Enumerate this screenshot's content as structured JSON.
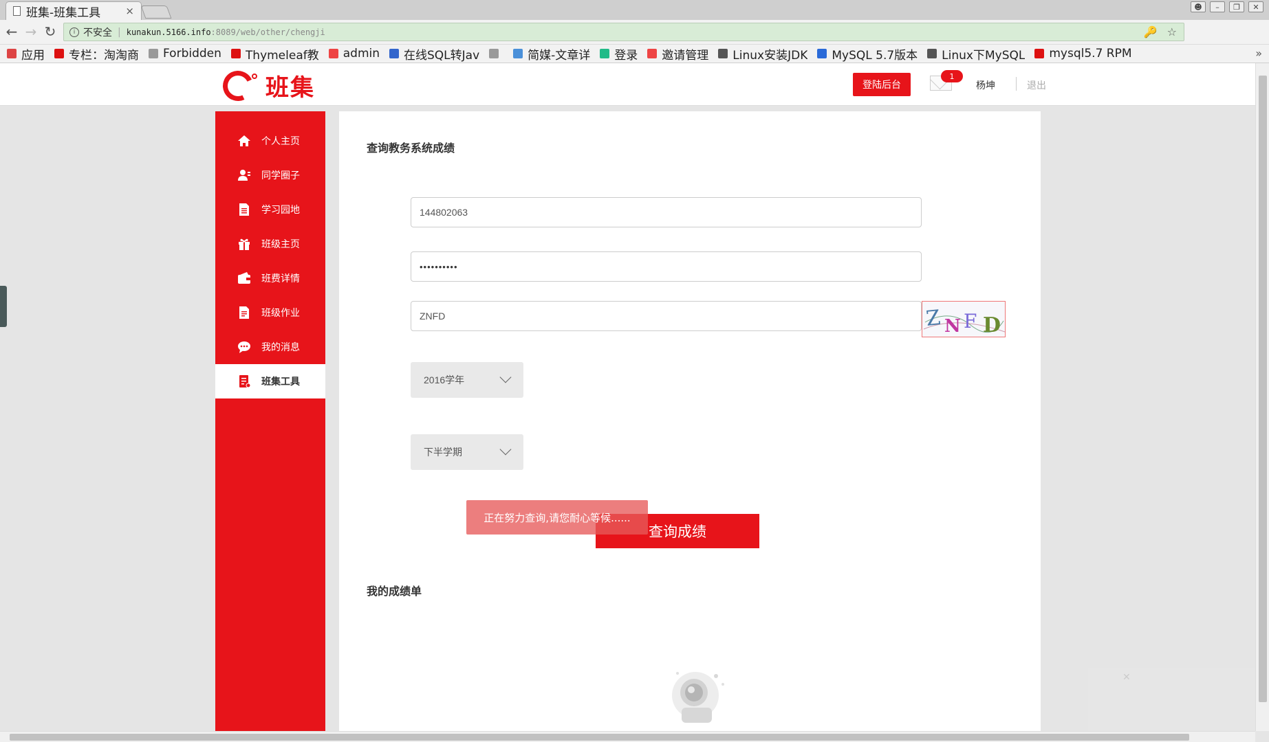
{
  "browser": {
    "tab_title": "班集-班集工具",
    "tab_close": "×",
    "security_label": "不安全",
    "url_host": "kunakun.5166.info",
    "url_path": ":8089/web/other/chengji",
    "bookmarks": [
      {
        "label": "应用",
        "icon": "apps-icon",
        "color": "#d44"
      },
      {
        "label": "专栏：淘淘商",
        "icon": "csdn-icon",
        "color": "#d11"
      },
      {
        "label": "Forbidden",
        "icon": "page-icon",
        "color": "#999"
      },
      {
        "label": "Thymeleaf教",
        "icon": "csdn-icon",
        "color": "#d11"
      },
      {
        "label": "admin",
        "icon": "jm-icon",
        "color": "#e44"
      },
      {
        "label": "在线SQL转Jav",
        "icon": "code-icon",
        "color": "#36c"
      },
      {
        "label": "",
        "icon": "page-icon",
        "color": "#999"
      },
      {
        "label": "简媒-文章详",
        "icon": "jm-blue-icon",
        "color": "#4a90d9"
      },
      {
        "label": "登录",
        "icon": "green-icon",
        "color": "#2b8"
      },
      {
        "label": "邀请管理",
        "icon": "jm-icon",
        "color": "#e44"
      },
      {
        "label": "Linux安装JDK",
        "icon": "linux-icon",
        "color": "#555"
      },
      {
        "label": "MySQL 5.7版本",
        "icon": "baidu-icon",
        "color": "#2a6ad8"
      },
      {
        "label": "Linux下MySQL",
        "icon": "linux-icon",
        "color": "#555"
      },
      {
        "label": "mysql5.7 RPM",
        "icon": "csdn-icon",
        "color": "#d11"
      }
    ]
  },
  "header": {
    "logo_text": "班集",
    "admin_button": "登陆后台",
    "mail_badge": "1",
    "username": "杨坤",
    "logout": "退出"
  },
  "sidebar": {
    "items": [
      {
        "label": "个人主页",
        "icon": "home-icon",
        "active": false
      },
      {
        "label": "同学圈子",
        "icon": "user-icon",
        "active": false
      },
      {
        "label": "学习园地",
        "icon": "document-icon",
        "active": false
      },
      {
        "label": "班级主页",
        "icon": "gift-icon",
        "active": false
      },
      {
        "label": "班费详情",
        "icon": "wallet-icon",
        "active": false
      },
      {
        "label": "班级作业",
        "icon": "homework-icon",
        "active": false
      },
      {
        "label": "我的消息",
        "icon": "chat-icon",
        "active": false
      },
      {
        "label": "班集工具",
        "icon": "tools-icon",
        "active": true
      }
    ]
  },
  "main": {
    "title": "查询教务系统成绩",
    "student_id": "144802063",
    "password_mask": "••••••••••",
    "captcha_value": "ZNFD",
    "captcha_image_text": "ZNFD",
    "year_select": "2016学年",
    "term_select": "下半学期",
    "query_button": "查询成绩",
    "toast": "正在努力查询,请您耐心等候......",
    "results_title": "我的成绩单"
  },
  "colors": {
    "brand": "#e7141a",
    "toast": "#e75a5a"
  }
}
